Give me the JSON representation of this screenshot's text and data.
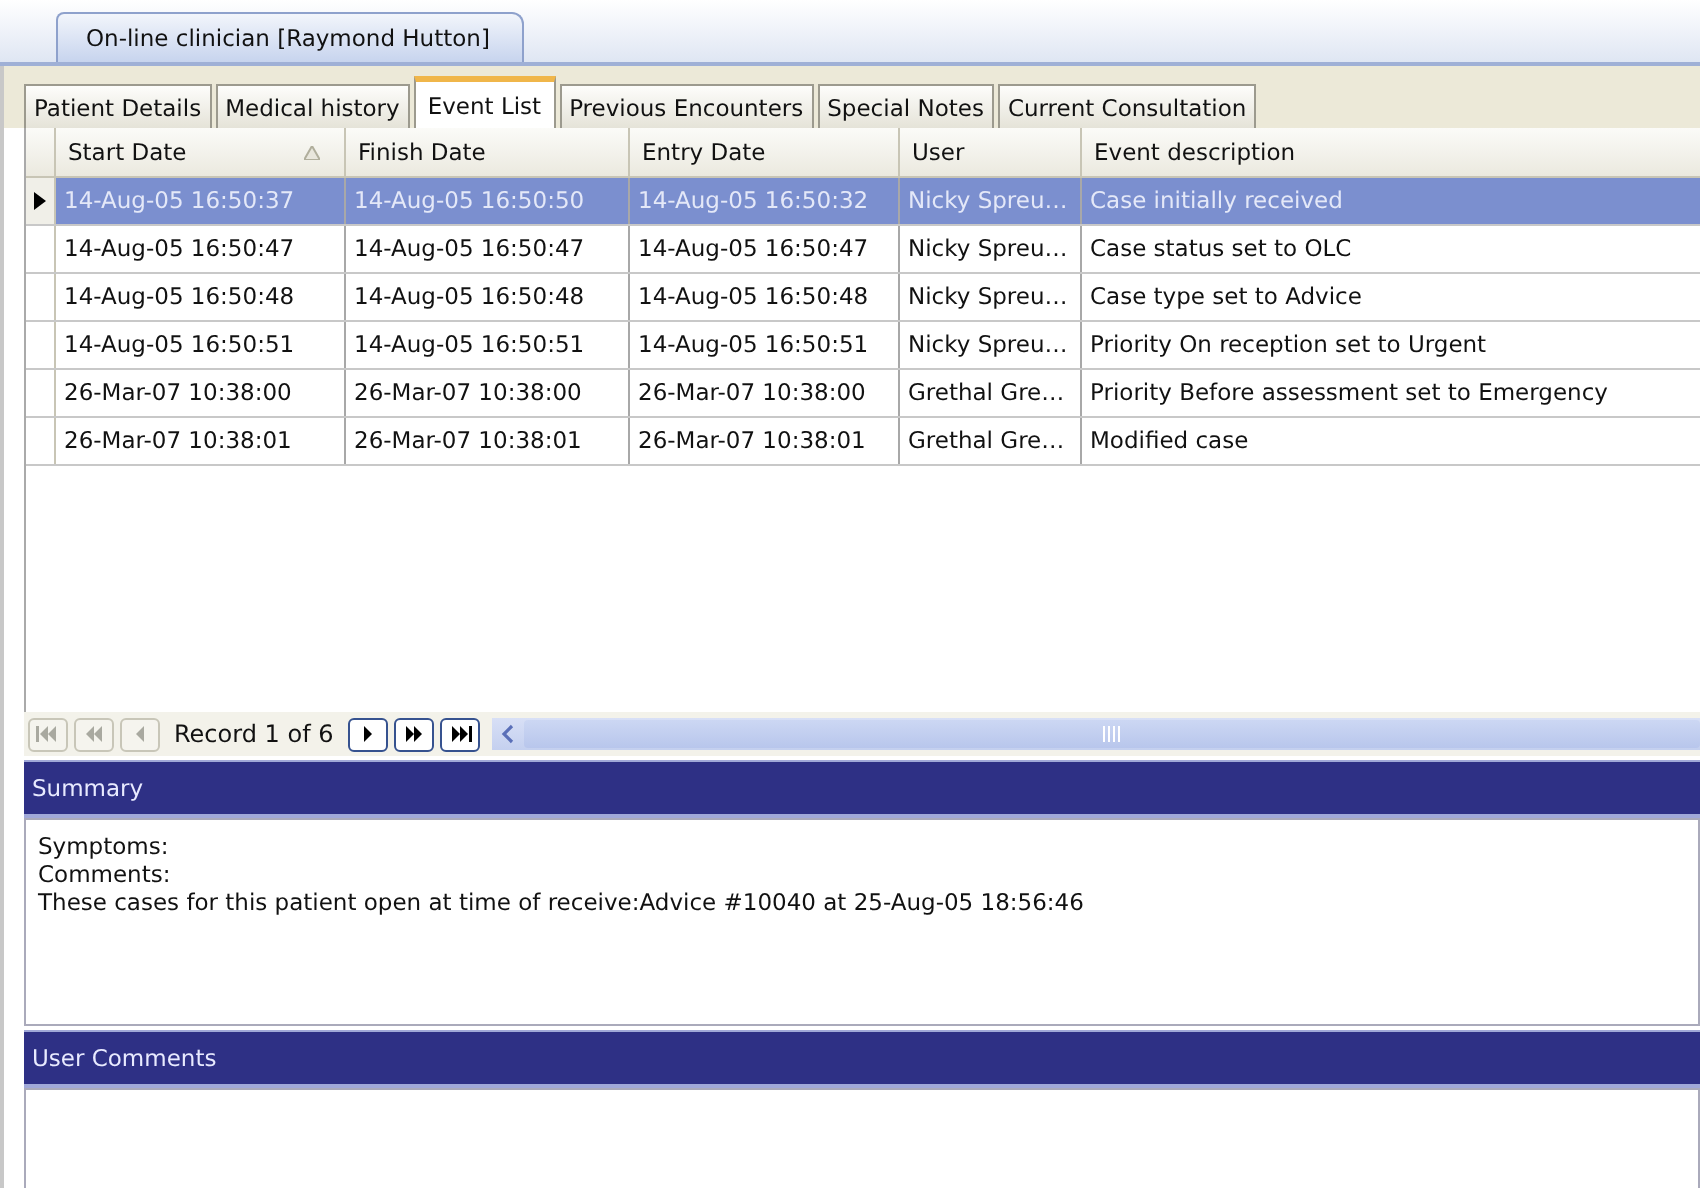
{
  "document_tab": {
    "title": "On-line clinician [Raymond Hutton]"
  },
  "tabs": [
    {
      "label": "Patient Details",
      "selected": false
    },
    {
      "label": "Medical history",
      "selected": false
    },
    {
      "label": "Event List",
      "selected": true
    },
    {
      "label": "Previous Encounters",
      "selected": false
    },
    {
      "label": "Special Notes",
      "selected": false
    },
    {
      "label": "Current Consultation",
      "selected": false
    }
  ],
  "table": {
    "columns": [
      {
        "label": "Start Date",
        "sorted": true
      },
      {
        "label": "Finish Date",
        "sorted": false
      },
      {
        "label": "Entry Date",
        "sorted": false
      },
      {
        "label": "User",
        "sorted": false
      },
      {
        "label": "Event description",
        "sorted": false
      }
    ],
    "rows": [
      {
        "selected": true,
        "cells": [
          "14-Aug-05 16:50:37",
          "14-Aug-05 16:50:50",
          "14-Aug-05 16:50:32",
          "Nicky Spreu…",
          "Case initially received"
        ]
      },
      {
        "selected": false,
        "cells": [
          "14-Aug-05 16:50:47",
          "14-Aug-05 16:50:47",
          "14-Aug-05 16:50:47",
          "Nicky Spreu…",
          "Case status set to OLC"
        ]
      },
      {
        "selected": false,
        "cells": [
          "14-Aug-05 16:50:48",
          "14-Aug-05 16:50:48",
          "14-Aug-05 16:50:48",
          "Nicky Spreu…",
          "Case type set to Advice"
        ]
      },
      {
        "selected": false,
        "cells": [
          "14-Aug-05 16:50:51",
          "14-Aug-05 16:50:51",
          "14-Aug-05 16:50:51",
          "Nicky Spreu…",
          "Priority On reception set to Urgent"
        ]
      },
      {
        "selected": false,
        "cells": [
          "26-Mar-07 10:38:00",
          "26-Mar-07 10:38:00",
          "26-Mar-07 10:38:00",
          "Grethal Gre…",
          "Priority Before assessment set to Emergency"
        ]
      },
      {
        "selected": false,
        "cells": [
          "26-Mar-07 10:38:01",
          "26-Mar-07 10:38:01",
          "26-Mar-07 10:38:01",
          "Grethal Gre…",
          "Modified case"
        ]
      }
    ]
  },
  "navigator": {
    "record": "Record 1 of 6",
    "buttons": [
      {
        "kind": "first",
        "disabled": true
      },
      {
        "kind": "prev-page",
        "disabled": true
      },
      {
        "kind": "prev",
        "disabled": true
      },
      {
        "kind": "record"
      },
      {
        "kind": "next",
        "disabled": false
      },
      {
        "kind": "next-page",
        "disabled": false
      },
      {
        "kind": "last",
        "disabled": false
      }
    ]
  },
  "summary": {
    "title": "Summary",
    "lines": [
      "Symptoms:",
      "Comments:",
      "These cases for this patient open at time of receive:Advice #10040 at 25-Aug-05 18:56:46"
    ]
  },
  "user_comments": {
    "title": "User Comments"
  }
}
